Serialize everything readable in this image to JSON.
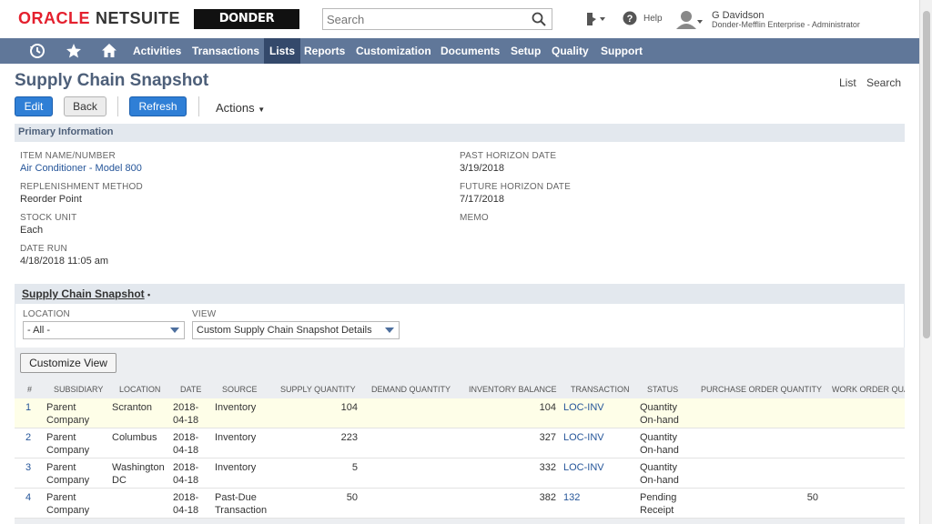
{
  "header": {
    "oracle": "ORACLE",
    "netsuite": "NETSUITE",
    "company_logo": "DONDER MEFFLIN",
    "search_placeholder": "Search",
    "help": "Help",
    "user_name": "G Davidson",
    "user_role": "Donder-Mefflin Enterprise - Administrator"
  },
  "nav": {
    "items": [
      "Activities",
      "Transactions",
      "Lists",
      "Reports",
      "Customization",
      "Documents",
      "Setup",
      "Quality",
      "Support"
    ],
    "active": "Lists"
  },
  "page": {
    "title": "Supply Chain Snapshot",
    "list_link": "List",
    "search_link": "Search",
    "edit": "Edit",
    "back": "Back",
    "refresh": "Refresh",
    "actions": "Actions"
  },
  "primary": {
    "section_label": "Primary Information",
    "fields_left": [
      {
        "label": "ITEM NAME/NUMBER",
        "value": "Air Conditioner - Model 800"
      },
      {
        "label": "REPLENISHMENT METHOD",
        "value": "Reorder Point"
      },
      {
        "label": "STOCK UNIT",
        "value": "Each"
      },
      {
        "label": "DATE RUN",
        "value": "4/18/2018 11:05 am"
      }
    ],
    "fields_right": [
      {
        "label": "PAST HORIZON DATE",
        "value": "3/19/2018"
      },
      {
        "label": "FUTURE HORIZON DATE",
        "value": "7/17/2018"
      },
      {
        "label": "MEMO",
        "value": ""
      }
    ]
  },
  "subtab": {
    "label": "Supply Chain Snapshot",
    "location_label": "LOCATION",
    "location_value": "- All -",
    "view_label": "VIEW",
    "view_value": "Custom Supply Chain Snapshot Details",
    "customize_view": "Customize View"
  },
  "table": {
    "headers": [
      "#",
      "SUBSIDIARY",
      "LOCATION",
      "DATE",
      "SOURCE",
      "SUPPLY QUANTITY",
      "DEMAND QUANTITY",
      "INVENTORY BALANCE",
      "TRANSACTION",
      "STATUS",
      "PURCHASE ORDER QUANTITY",
      "WORK ORDER QUA"
    ],
    "rows": [
      {
        "num": "1",
        "sub1": "Parent",
        "sub2": "Company",
        "loc1": "Scranton",
        "loc2": "",
        "date1": "2018-",
        "date2": "04-18",
        "src1": "Inventory",
        "src2": "",
        "supply": "104",
        "demand": "",
        "balance": "104",
        "txn": "LOC-INV",
        "status1": "Quantity",
        "status2": "On-hand",
        "po": ""
      },
      {
        "num": "2",
        "sub1": "Parent",
        "sub2": "Company",
        "loc1": "Columbus",
        "loc2": "",
        "date1": "2018-",
        "date2": "04-18",
        "src1": "Inventory",
        "src2": "",
        "supply": "223",
        "demand": "",
        "balance": "327",
        "txn": "LOC-INV",
        "status1": "Quantity",
        "status2": "On-hand",
        "po": ""
      },
      {
        "num": "3",
        "sub1": "Parent",
        "sub2": "Company",
        "loc1": "Washington",
        "loc2": "DC",
        "date1": "2018-",
        "date2": "04-18",
        "src1": "Inventory",
        "src2": "",
        "supply": "5",
        "demand": "",
        "balance": "332",
        "txn": "LOC-INV",
        "status1": "Quantity",
        "status2": "On-hand",
        "po": ""
      },
      {
        "num": "4",
        "sub1": "Parent",
        "sub2": "Company",
        "loc1": "",
        "loc2": "",
        "date1": "2018-",
        "date2": "04-18",
        "src1": "Past-Due",
        "src2": "Transaction",
        "supply": "50",
        "demand": "",
        "balance": "382",
        "txn": "132",
        "status1": "Pending",
        "status2": "Receipt",
        "po": "50"
      }
    ]
  }
}
